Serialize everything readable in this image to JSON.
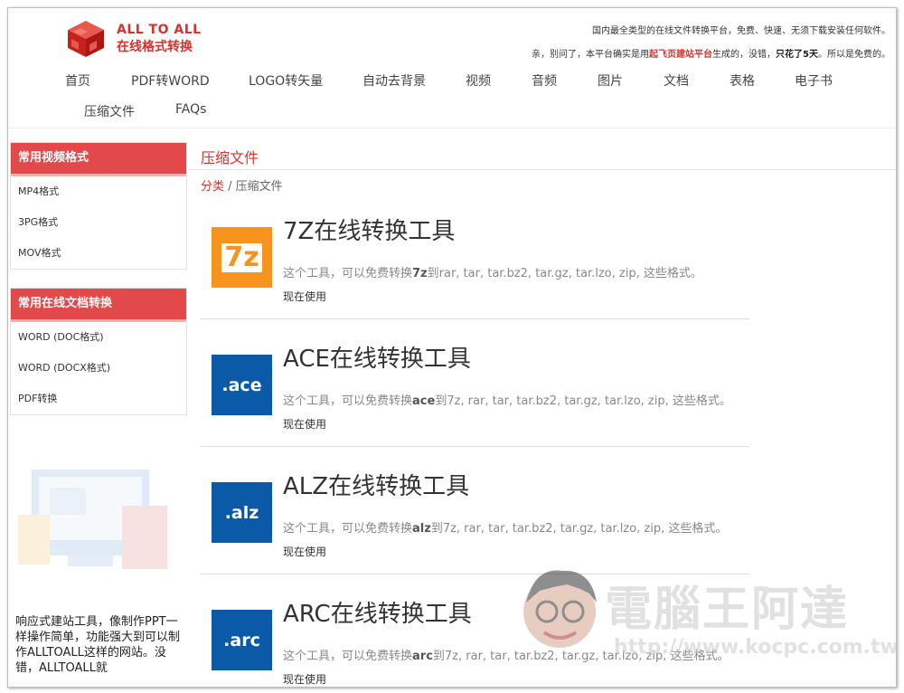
{
  "header": {
    "logo_line1": "ALL TO ALL",
    "logo_line2": "在线格式转换",
    "note1": "国内最全类型的在线文件转换平台，免费、快速、无须下载安装任何软件。",
    "note2_a": "亲，别问了，本平台确实是用",
    "note2_link": "起飞页建站平台",
    "note2_b": "生成的，没错，",
    "note2_bold": "只花了5天",
    "note2_c": "。所以是免费的。"
  },
  "nav": [
    "首页",
    "PDF转WORD",
    "LOGO转矢量",
    "自动去背景",
    "视频",
    "音频",
    "图片",
    "文档",
    "表格",
    "电子书",
    "压缩文件",
    "FAQs"
  ],
  "sidebar": {
    "video": {
      "title": "常用视频格式",
      "items": [
        "MP4格式",
        "3PG格式",
        "MOV格式"
      ]
    },
    "docs": {
      "title": "常用在线文档转换",
      "items": [
        "WORD (DOC格式)",
        "WORD (DOCX格式)",
        "PDF转换"
      ]
    },
    "promo": "响应式建站工具，像制作PPT一样操作简单，功能强大到可以制作ALLTOALL这样的网站。没错，ALLTOALL就"
  },
  "main": {
    "title": "压缩文件",
    "breadcrumb_link": "分类",
    "breadcrumb_sep": " / ",
    "breadcrumb_current": "压缩文件",
    "tools": [
      {
        "icon": "7z",
        "color": "#f7941d",
        "title": "7Z在线转换工具",
        "desc_a": "这个工具，可以免费转换",
        "desc_fmt": "7z",
        "desc_b": "到rar, tar, tar.bz2, tar.gz, tar.lzo, zip, 这些格式。",
        "link": "现在使用"
      },
      {
        "icon": ".ace",
        "color": "#0b5aa8",
        "title": "ACE在线转换工具",
        "desc_a": "这个工具，可以免费转换",
        "desc_fmt": "ace",
        "desc_b": "到7z, rar, tar, tar.bz2, tar.gz, tar.lzo, zip, 这些格式。",
        "link": "现在使用"
      },
      {
        "icon": ".alz",
        "color": "#0b5aa8",
        "title": "ALZ在线转换工具",
        "desc_a": "这个工具，可以免费转换",
        "desc_fmt": "alz",
        "desc_b": "到7z, rar, tar, tar.bz2, tar.gz, tar.lzo, zip, 这些格式。",
        "link": "现在使用"
      },
      {
        "icon": ".arc",
        "color": "#0b5aa8",
        "title": "ARC在线转换工具",
        "desc_a": "这个工具，可以免费转换",
        "desc_fmt": "arc",
        "desc_b": "到7z, rar, tar, tar.bz2, tar.gz, tar.lzo, zip, 这些格式。",
        "link": "现在使用"
      }
    ]
  },
  "watermark": {
    "text": "電腦王阿達",
    "url": "http://www.kocpc.com.tw"
  },
  "colors": {
    "accent": "#d9322c",
    "sidebar_head": "#e1494a"
  }
}
